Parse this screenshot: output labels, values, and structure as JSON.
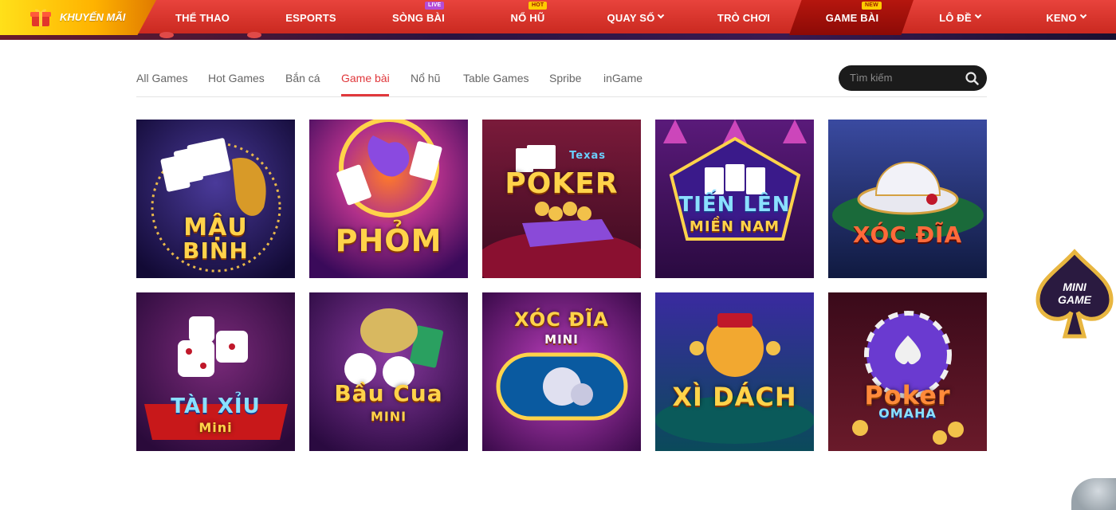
{
  "promo": {
    "label": "KHUYẾN MÃI",
    "icon": "gift-icon"
  },
  "nav": {
    "items": [
      {
        "label": "THỂ THAO"
      },
      {
        "label": "ESPORTS"
      },
      {
        "label": "SÒNG BÀI",
        "badge": "LIVE"
      },
      {
        "label": "NỔ HŨ",
        "badge": "HOT"
      },
      {
        "label": "QUAY SỐ"
      },
      {
        "label": "TRÒ CHƠI"
      },
      {
        "label": "GAME BÀI",
        "badge": "NEW"
      },
      {
        "label": "LÔ ĐỀ"
      },
      {
        "label": "KENO"
      }
    ]
  },
  "tabs": {
    "items": [
      "All Games",
      "Hot Games",
      "Bắn cá",
      "Game bài",
      "Nổ hũ",
      "Table Games",
      "Spribe",
      "inGame"
    ],
    "active": "Game bài"
  },
  "search": {
    "placeholder": "Tìm kiếm"
  },
  "games": [
    {
      "title_line1": "MẬU",
      "title_line2": "BINH"
    },
    {
      "title_line1": "PHỎM"
    },
    {
      "title_line1": "Texas",
      "title_line2": "POKER"
    },
    {
      "title_line1": "TIẾN LÊN",
      "title_line2": "MIỀN NAM"
    },
    {
      "title_line1": "XÓC ĐĨA"
    },
    {
      "title_line1": "TÀI XỈU",
      "title_line2": "Mini"
    },
    {
      "title_line1": "Bầu Cua",
      "title_line2": "MINI"
    },
    {
      "title_line1": "XÓC ĐĨA",
      "title_line2": "MINI"
    },
    {
      "title_line1": "XÌ DÁCH"
    },
    {
      "title_line1": "Poker",
      "title_line2": "OMAHA"
    }
  ],
  "mini_game": {
    "line1": "MINI",
    "line2": "GAME"
  },
  "colors": {
    "nav": "#d8342c",
    "accent": "#e0383c",
    "promo": "#ffc400",
    "search_bg": "#1b1b1b"
  }
}
